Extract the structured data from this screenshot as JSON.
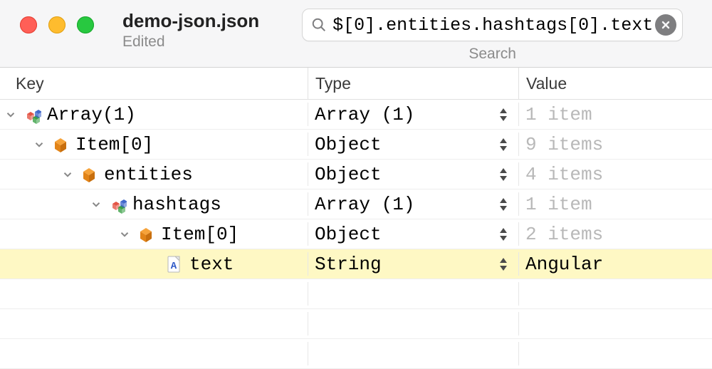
{
  "window": {
    "title": "demo-json.json",
    "subtitle": "Edited"
  },
  "search": {
    "value": "$[0].entities.hashtags[0].text",
    "caption": "Search"
  },
  "columns": {
    "key": "Key",
    "type": "Type",
    "value": "Value"
  },
  "rows": [
    {
      "depth": 0,
      "chevron": "down",
      "icon": "array",
      "key": "Array(1)",
      "type": "Array (1)",
      "value": "1 item",
      "value_muted": true,
      "highlight": false
    },
    {
      "depth": 1,
      "chevron": "down",
      "icon": "object",
      "key": "Item[0]",
      "type": "Object",
      "value": "9 items",
      "value_muted": true,
      "highlight": false
    },
    {
      "depth": 2,
      "chevron": "down",
      "icon": "object",
      "key": "entities",
      "type": "Object",
      "value": "4 items",
      "value_muted": true,
      "highlight": false
    },
    {
      "depth": 3,
      "chevron": "down",
      "icon": "array",
      "key": "hashtags",
      "type": "Array (1)",
      "value": "1 item",
      "value_muted": true,
      "highlight": false
    },
    {
      "depth": 4,
      "chevron": "down",
      "icon": "object",
      "key": "Item[0]",
      "type": "Object",
      "value": "2 items",
      "value_muted": true,
      "highlight": false
    },
    {
      "depth": 5,
      "chevron": "none",
      "icon": "string",
      "key": "text",
      "type": "String",
      "value": "Angular",
      "value_muted": false,
      "highlight": true
    }
  ]
}
